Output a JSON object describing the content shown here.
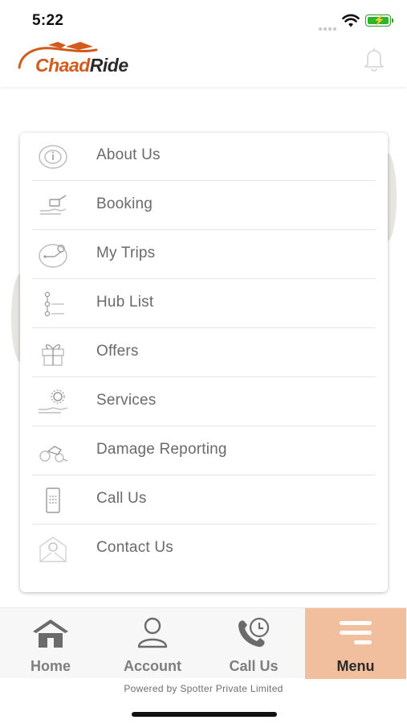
{
  "status_bar": {
    "time": "5:22"
  },
  "header": {
    "brand_part1": "Chaad",
    "brand_part2": "Ride"
  },
  "menu": {
    "items": [
      {
        "label": "About Us",
        "icon": "info-circle-icon"
      },
      {
        "label": "Booking",
        "icon": "booking-hand-icon"
      },
      {
        "label": "My Trips",
        "icon": "trip-route-icon"
      },
      {
        "label": "Hub List",
        "icon": "hub-list-icon"
      },
      {
        "label": "Offers",
        "icon": "gift-icon"
      },
      {
        "label": "Services",
        "icon": "service-gear-hand-icon"
      },
      {
        "label": "Damage Reporting",
        "icon": "damage-bike-icon"
      },
      {
        "label": "Call Us",
        "icon": "phone-keypad-icon"
      },
      {
        "label": "Contact Us",
        "icon": "envelope-icon"
      }
    ]
  },
  "bottom_nav": {
    "items": [
      {
        "label": "Home",
        "icon": "home-icon",
        "active": false
      },
      {
        "label": "Account",
        "icon": "account-icon",
        "active": false
      },
      {
        "label": "Call Us",
        "icon": "call-clock-icon",
        "active": false
      },
      {
        "label": "Menu",
        "icon": "menu-icon",
        "active": true
      }
    ]
  },
  "footer": {
    "powered_by": "Powered by Spotter Private Limited"
  },
  "colors": {
    "brand_orange": "#d25a1c",
    "active_tab": "#f1bf9d",
    "menu_text": "#6a6a6a"
  }
}
